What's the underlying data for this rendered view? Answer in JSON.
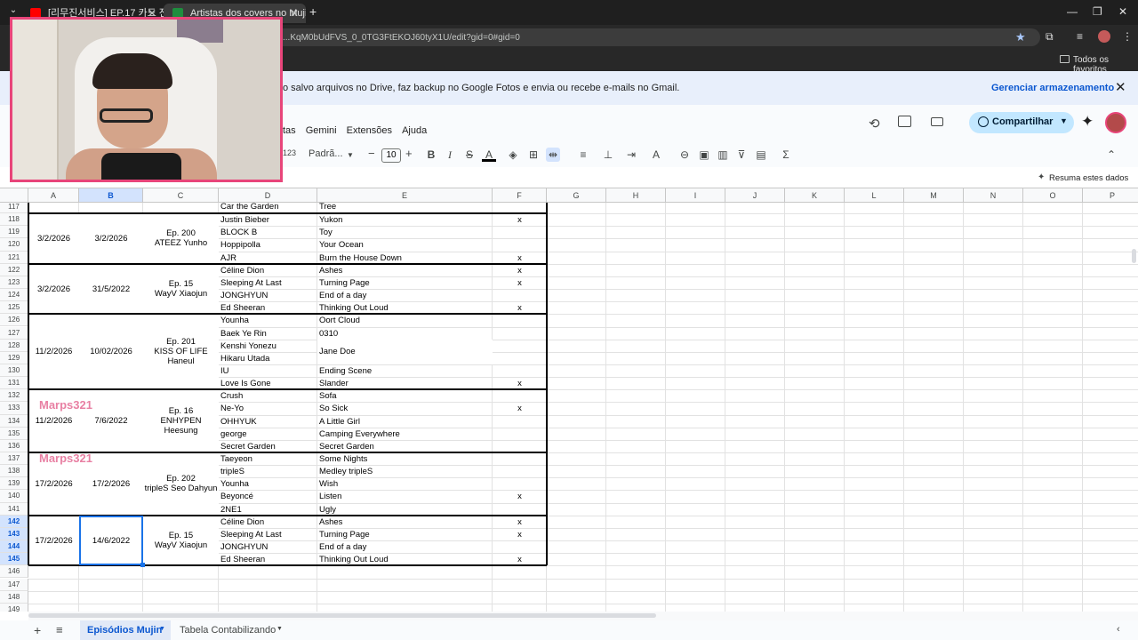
{
  "browser": {
    "tabs": [
      {
        "label": "[리무진서비스] EP.17 카드 전소",
        "active": false
      },
      {
        "label": "Artistas dos covers no Mujin - G",
        "active": true
      }
    ],
    "url": "...KqM0bUdFVS_0_0TG3FtEKOJ60tyX1U/edit?gid=0#gid=0",
    "bookmarks_label": "Todos os favoritos"
  },
  "banner": {
    "text": "o salvo arquivos no Drive, faz backup no Google Fotos e envia ou recebe e-mails no Gmail.",
    "action": "Gerenciar armazenamento"
  },
  "menu": [
    "tas",
    "Gemini",
    "Extensões",
    "Ajuda"
  ],
  "header": {
    "share_label": "Compartilhar"
  },
  "toolbar": {
    "font_name": "Padrã...",
    "font_size": "10",
    "num_fmt": "123"
  },
  "formula": {
    "summarize": "Resuma estes dados"
  },
  "grid": {
    "columns": [
      "A",
      "B",
      "C",
      "D",
      "E",
      "F",
      "G",
      "H",
      "I",
      "J",
      "K",
      "L",
      "M",
      "N",
      "O",
      "P"
    ],
    "rows": [
      "117",
      "118",
      "119",
      "120",
      "121",
      "122",
      "123",
      "124",
      "125",
      "126",
      "127",
      "128",
      "129",
      "130",
      "131",
      "132",
      "133",
      "134",
      "135",
      "136",
      "137",
      "138",
      "139",
      "140",
      "141",
      "142",
      "143",
      "144",
      "145",
      "146",
      "147",
      "148",
      "149"
    ],
    "groups": [
      {
        "a": "3/2/2026",
        "b": "3/2/2026",
        "c": "Ep. 200\nATEEZ Yunho",
        "items": [
          [
            "Justin Bieber",
            "Yukon",
            "x"
          ],
          [
            "BLOCK B",
            "Toy",
            ""
          ],
          [
            "Hoppipolla",
            "Your Ocean",
            ""
          ],
          [
            "AJR",
            "Burn the House Down",
            "x"
          ]
        ]
      },
      {
        "a": "3/2/2026",
        "b": "31/5/2022",
        "c": "Ep. 15\nWayV Xiaojun",
        "items": [
          [
            "Céline Dion",
            "Ashes",
            "x"
          ],
          [
            "Sleeping At Last",
            "Turning Page",
            "x"
          ],
          [
            "JONGHYUN",
            "End of a day",
            ""
          ],
          [
            "Ed Sheeran",
            "Thinking Out Loud",
            "x"
          ]
        ]
      },
      {
        "a": "11/2/2026",
        "b": "10/02/2026",
        "c": "Ep. 201\nKISS OF LIFE\nHaneul",
        "items": [
          [
            "Younha",
            "Oort Cloud",
            ""
          ],
          [
            "Baek Ye Rin",
            "0310",
            ""
          ],
          [
            "Kenshi Yonezu",
            "",
            ""
          ],
          [
            "Hikaru Utada",
            "",
            ""
          ],
          [
            "IU",
            "Ending Scene",
            ""
          ],
          [
            "Love Is Gone",
            "Slander",
            "x"
          ]
        ],
        "merged_e": "Jane Doe"
      },
      {
        "a": "11/2/2026",
        "b": "7/6/2022",
        "c": "Ep. 16\nENHYPEN\nHeesung",
        "items": [
          [
            "Crush",
            "Sofa",
            ""
          ],
          [
            "Ne-Yo",
            "So Sick",
            "x"
          ],
          [
            "OHHYUK",
            "A Little Girl",
            ""
          ],
          [
            "george",
            "Camping Everywhere",
            ""
          ],
          [
            "Secret Garden",
            "Secret Garden",
            ""
          ]
        ]
      },
      {
        "a": "17/2/2026",
        "b": "17/2/2026",
        "c": "Ep. 202\ntripleS Seo Dahyun",
        "items": [
          [
            "Taeyeon",
            "Some Nights",
            ""
          ],
          [
            "tripleS",
            "Medley tripleS",
            ""
          ],
          [
            "Younha",
            "Wish",
            ""
          ],
          [
            "Beyoncé",
            "Listen",
            "x"
          ],
          [
            "2NE1",
            "Ugly",
            ""
          ]
        ]
      },
      {
        "a": "17/2/2026",
        "b": "14/6/2022",
        "c": "Ep. 15\nWayV Xiaojun",
        "items": [
          [
            "Céline Dion",
            "Ashes",
            "x"
          ],
          [
            "Sleeping At Last",
            "Turning Page",
            "x"
          ],
          [
            "JONGHYUN",
            "End of a day",
            ""
          ],
          [
            "Ed Sheeran",
            "Thinking Out Loud",
            "x"
          ]
        ]
      }
    ],
    "partial_row": {
      "d": "Car the Garden",
      "e": "Tree"
    }
  },
  "sheets": [
    {
      "label": "Episódios Mujin",
      "active": true
    },
    {
      "label": "Tabela Contabilizando",
      "active": false
    }
  ],
  "overlay": {
    "watermark": "Marps321"
  }
}
